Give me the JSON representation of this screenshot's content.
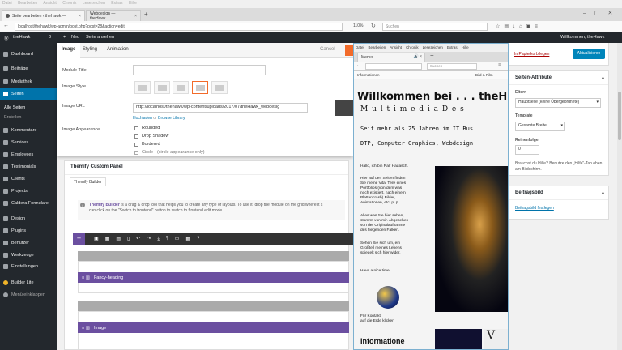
{
  "browser": {
    "menubar": [
      "Datei",
      "Bearbeiten",
      "Ansicht",
      "Chronik",
      "Lesezeichen",
      "Extras",
      "Hilfe"
    ],
    "tabs": [
      {
        "label": "Seite bearbeiten ‹ theHawk —",
        "close": "×"
      },
      {
        "label": "Webdesign — theHawk",
        "close": "×"
      }
    ],
    "new_tab": "+",
    "url": "localhost/thehawk/wp-admin/post.php?post=28&action=edit",
    "zoom": "110%",
    "search_placeholder": "Suchen"
  },
  "adminbar": {
    "site": "theHawk",
    "comments": "0",
    "new": "Neu",
    "view": "Seite ansehen",
    "welcome": "Willkommen, theHawk"
  },
  "sidebar": {
    "items": [
      {
        "label": "Dashboard"
      },
      {
        "label": "Beiträge"
      },
      {
        "label": "Mediathek"
      },
      {
        "label": "Seiten"
      },
      {
        "label": "Alle Seiten"
      },
      {
        "label": "Erstellen"
      },
      {
        "label": "Kommentare"
      },
      {
        "label": "Services"
      },
      {
        "label": "Employees"
      },
      {
        "label": "Testimonials"
      },
      {
        "label": "Clients"
      },
      {
        "label": "Projects"
      },
      {
        "label": "Caldera Formulare"
      },
      {
        "label": "Design"
      },
      {
        "label": "Plugins"
      },
      {
        "label": "Benutzer"
      },
      {
        "label": "Werkzeuge"
      },
      {
        "label": "Einstellungen"
      },
      {
        "label": "Builder Lite"
      },
      {
        "label": "Menü einklappen"
      }
    ]
  },
  "dialog": {
    "tabs": [
      "Image",
      "Styling",
      "Animation"
    ],
    "cancel": "Cancel",
    "fields": {
      "module_title": "Module Title",
      "image_style": "Image Style",
      "image_url": "Image URL",
      "image_url_value": "http://localhost/thehawk/wp-content/uploads/2017/07/theHawk_webdesig",
      "upload": "Hochladen",
      "or": "or",
      "browse": "Browse Library",
      "image_appearance": "Image Appearance",
      "appearance_opts": [
        "Rounded",
        "Drop Shadow",
        "Bordered",
        "Circle - (circle appearance only)"
      ]
    }
  },
  "panel": {
    "title": "Themify Custom Panel",
    "tab": "Themify Builder",
    "info_bold": "Themify Builder",
    "info": " is a drag & drop tool that helps you to create any type of layouts. To use it: drop the module on the grid where it s",
    "info2": "can click on the \"Switch to frontend\" button to switch to frontend edit mode.",
    "rows": [
      "Fancy-heading",
      "Image"
    ]
  },
  "overlay": {
    "menubar": [
      "Datei",
      "Bearbeiten",
      "Ansicht",
      "Chronik",
      "Lesezeichen",
      "Extras",
      "Hilfe"
    ],
    "tab": "Menus",
    "search": "Suchen",
    "bookmark_left": "Informationen",
    "bookmark_right": "Bild & Film",
    "heading": "Willkommen bei . . . theH",
    "subheading": "M u l t i m e d i a   D e s",
    "line1": "Seit mehr als 25 Jahren im IT Bus",
    "line2": "DTP, Computer Graphics, Webdesign",
    "p1": "Hallo, ich bin Ralf Hadasch.",
    "p2": "Hier auf den Seiten finden\nSie meine Vita, Teile eines\nPortfolios (von dem was\nnoch existiert, nach einem\nPlattencrash) Bilder,\nAnimationen, etc. p. p..",
    "p3": "Alles was Sie hier sehen,\nstammt von mir. Abgesehen\nvon der Originalaufnahme\ndes fliegenden Falken.",
    "p4": "Sehen Sie sich um, ein\nGroßteil meines Lebens\nspiegelt sich hier wider.",
    "p5": "Have a nice time . . .",
    "p6": "Für Kontakt\nauf die Erde klicken",
    "info_head": "Informatione"
  },
  "right": {
    "trash": "In Papierkorb legen",
    "update": "Aktualisieren",
    "attr_title": "Seiten-Attribute",
    "parent_label": "Eltern",
    "parent_value": "Hauptseite (keine Übergeordnete)",
    "template_label": "Template",
    "template_value": "Gesamte Breite",
    "order_label": "Reihenfolge",
    "order_value": "0",
    "help": "Brauchst du Hilfe? Benutze den „Hilfe\"-Tab oben am Bildschirm.",
    "image_title": "Beitragsbild",
    "image_link": "Beitragsbild festlegen"
  },
  "colors": {
    "wp_dark": "#23282d",
    "wp_blue": "#0073aa",
    "builder_purple": "#6b4fa0",
    "accent_orange": "#f26b2a"
  }
}
